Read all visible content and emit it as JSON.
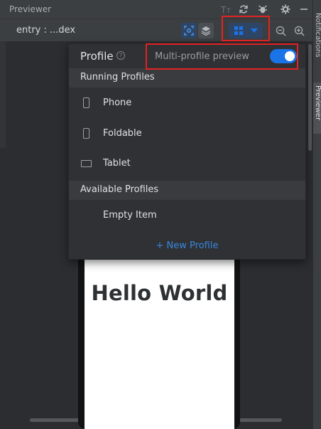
{
  "titlebar": {
    "title": "Previewer",
    "icons": [
      "text-size-icon",
      "refresh-icon",
      "bug-icon",
      "gear-icon",
      "minimize-icon"
    ]
  },
  "toolbar": {
    "entry_label": "entry : ...dex"
  },
  "right_strip": {
    "notifications_label": "Notifications",
    "previewer_label": "Previewer"
  },
  "popup": {
    "title": "Profile",
    "help_glyph": "?",
    "multi_profile_label": "Multi-profile preview",
    "multi_profile_enabled": true,
    "running_header": "Running Profiles",
    "running_profiles": [
      {
        "label": "Phone",
        "icon": "phone-icon"
      },
      {
        "label": "Foldable",
        "icon": "foldable-icon"
      },
      {
        "label": "Tablet",
        "icon": "tablet-icon"
      }
    ],
    "available_header": "Available Profiles",
    "available_profiles": [
      {
        "label": "Empty Item"
      }
    ],
    "new_profile_label": "+ New Profile"
  },
  "preview": {
    "hello_text": "Hello World"
  },
  "colors": {
    "accent": "#1a74e8",
    "link": "#3a86e0",
    "highlight": "#e32222",
    "background": "#2b2d30"
  }
}
